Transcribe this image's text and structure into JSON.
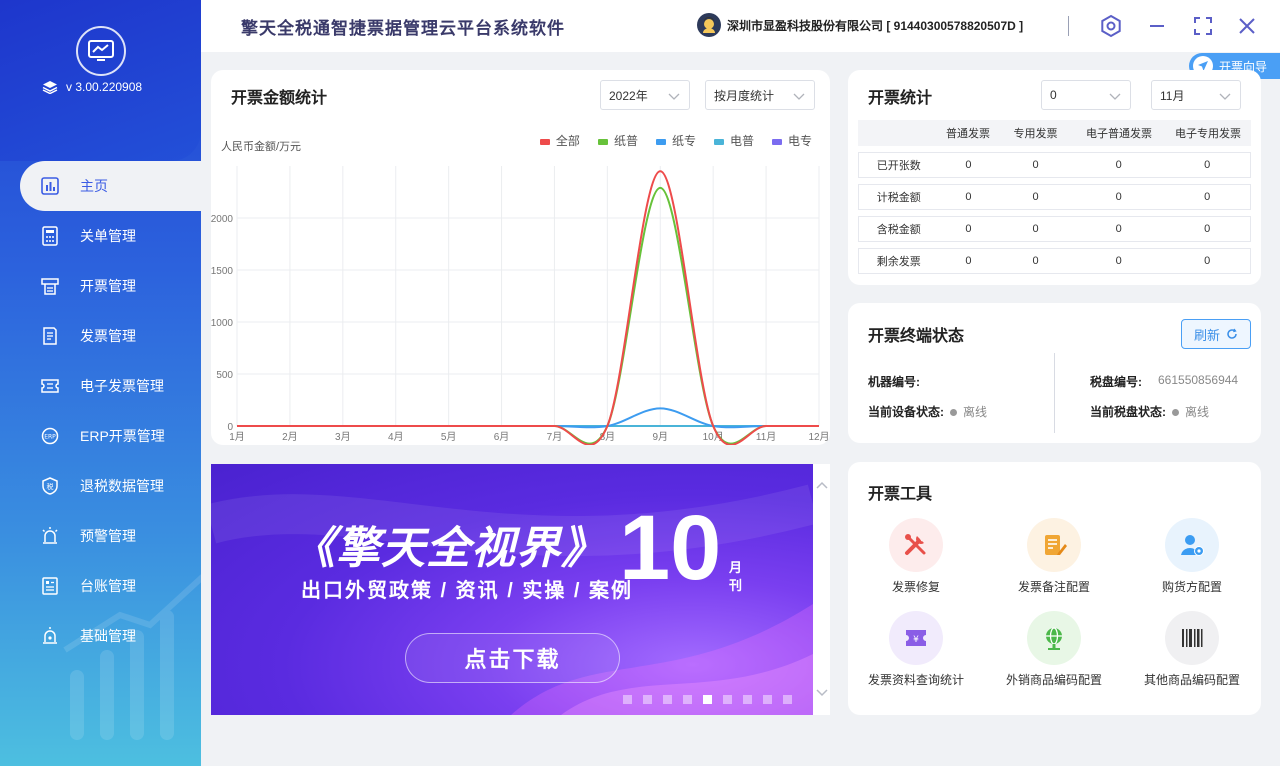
{
  "app": {
    "title": "擎天全税通智捷票据管理云平台系统软件",
    "version": "v 3.00.220908"
  },
  "header": {
    "company": "深圳市显盈科技股份有限公司 [ 91440300578820507D ]",
    "guide": "开票向导"
  },
  "sidebar": {
    "items": [
      {
        "label": "主页",
        "icon": "chart-icon"
      },
      {
        "label": "关单管理",
        "icon": "calculator-icon"
      },
      {
        "label": "开票管理",
        "icon": "printer-icon"
      },
      {
        "label": "发票管理",
        "icon": "document-icon"
      },
      {
        "label": "电子发票管理",
        "icon": "ticket-icon"
      },
      {
        "label": "ERP开票管理",
        "icon": "erp-icon"
      },
      {
        "label": "退税数据管理",
        "icon": "shield-icon"
      },
      {
        "label": "预警管理",
        "icon": "alarm-icon"
      },
      {
        "label": "台账管理",
        "icon": "ledger-icon"
      },
      {
        "label": "基础管理",
        "icon": "settings-alarm-icon"
      }
    ]
  },
  "amount_card": {
    "title": "开票金额统计",
    "year_select": "2022年",
    "mode_select": "按月度统计",
    "ylabel": "人民币金额/万元"
  },
  "chart_data": {
    "type": "line",
    "categories": [
      "1月",
      "2月",
      "3月",
      "4月",
      "5月",
      "6月",
      "7月",
      "8月",
      "9月",
      "10月",
      "11月",
      "12月"
    ],
    "ylim": [
      0,
      2500
    ],
    "yticks": [
      0,
      500,
      1000,
      1500,
      2000
    ],
    "grid": true,
    "legend_position": "top-right",
    "series": [
      {
        "name": "全部",
        "color": "#ee4b4b",
        "values": [
          0,
          0,
          0,
          0,
          0,
          0,
          0,
          0,
          2450,
          0,
          0,
          0
        ]
      },
      {
        "name": "纸普",
        "color": "#67c23a",
        "values": [
          0,
          0,
          0,
          0,
          0,
          0,
          0,
          0,
          2290,
          0,
          0,
          0
        ]
      },
      {
        "name": "纸专",
        "color": "#3d9cf0",
        "values": [
          0,
          0,
          0,
          0,
          0,
          0,
          0,
          0,
          170,
          0,
          0,
          0
        ]
      },
      {
        "name": "电普",
        "color": "#4ab4d8",
        "values": [
          0,
          0,
          0,
          0,
          0,
          0,
          0,
          0,
          0,
          0,
          0,
          0
        ]
      },
      {
        "name": "电专",
        "color": "#7b6cf0",
        "values": [
          0,
          0,
          0,
          0,
          0,
          0,
          0,
          0,
          0,
          0,
          0,
          0
        ]
      }
    ]
  },
  "stats_card": {
    "title": "开票统计",
    "select_a": "0",
    "select_b": "11月",
    "headers": [
      "",
      "普通发票",
      "专用发票",
      "电子普通发票",
      "电子专用发票"
    ],
    "rows": [
      [
        "已开张数",
        "0",
        "0",
        "0",
        "0"
      ],
      [
        "计税金额",
        "0",
        "0",
        "0",
        "0"
      ],
      [
        "含税金额",
        "0",
        "0",
        "0",
        "0"
      ],
      [
        "剩余发票",
        "0",
        "0",
        "0",
        "0"
      ]
    ]
  },
  "terminal_card": {
    "title": "开票终端状态",
    "refresh": "刷新",
    "machine_label": "机器编号:",
    "machine_value": "",
    "device_status_label": "当前设备状态:",
    "device_status": "离线",
    "disk_label": "税盘编号:",
    "disk_value": "661550856944",
    "disk_status_label": "当前税盘状态:",
    "disk_status": "离线"
  },
  "tools_card": {
    "title": "开票工具",
    "tools": [
      {
        "label": "发票修复",
        "icon": "repair-icon",
        "bg": "#fdecec"
      },
      {
        "label": "发票备注配置",
        "icon": "note-edit-icon",
        "bg": "#fdf2e2"
      },
      {
        "label": "购货方配置",
        "icon": "user-settings-icon",
        "bg": "#e8f3fd"
      },
      {
        "label": "发票资料查询统计",
        "icon": "invoice-query-icon",
        "bg": "#f1ebfc"
      },
      {
        "label": "外销商品编码配置",
        "icon": "globe-icon",
        "bg": "#e8f7e6"
      },
      {
        "label": "其他商品编码配置",
        "icon": "barcode-icon",
        "bg": "#f0f0f2"
      }
    ]
  },
  "banner": {
    "title": "《擎天全视界》",
    "number": "10",
    "unit": "月刊",
    "subtitle": "出口外贸政策 / 资讯 / 实操 / 案例",
    "button": "点击下载",
    "slides": 9,
    "active_slide": 4
  }
}
